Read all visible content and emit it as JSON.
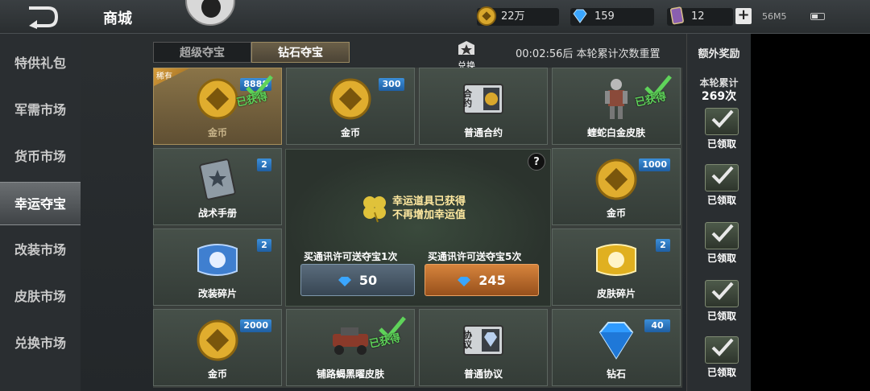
{
  "header": {
    "title": "商城",
    "gold": "22万",
    "diamond": "159",
    "card": "12",
    "add": "+",
    "network": "56M5"
  },
  "sidebar": {
    "items": [
      {
        "label": "特供礼包"
      },
      {
        "label": "军需市场"
      },
      {
        "label": "货币市场"
      },
      {
        "label": "幸运夺宝"
      },
      {
        "label": "改装市场"
      },
      {
        "label": "皮肤市场"
      },
      {
        "label": "兑换市场"
      }
    ],
    "active_index": 3
  },
  "tabs": [
    {
      "label": "超级夺宝",
      "active": false
    },
    {
      "label": "钻石夺宝",
      "active": true
    }
  ],
  "exchange_label": "兑换",
  "timer_text": "00:02:56后 本轮累计次数重置",
  "cells": [
    {
      "label": "金币",
      "badge": "8888",
      "obtained": "已获得",
      "tag": "稀有"
    },
    {
      "label": "金币",
      "badge": "300"
    },
    {
      "label": "普通合约",
      "icon_text": "合约"
    },
    {
      "label": "蝰蛇白金皮肤",
      "obtained": "已获得"
    },
    {
      "label": "战术手册",
      "badge": "2"
    },
    {
      "label": "金币",
      "badge": "1000"
    },
    {
      "label": "改装碎片",
      "badge": "2"
    },
    {
      "label": "皮肤碎片",
      "badge": "2"
    },
    {
      "label": "金币",
      "badge": "2000"
    },
    {
      "label": "铺路蝎黑曜皮肤",
      "obtained": "已获得"
    },
    {
      "label": "普通协议",
      "icon_text": "协议"
    },
    {
      "label": "钻石",
      "badge": "40"
    }
  ],
  "center": {
    "help": "?",
    "lucky_line1": "幸运道具已获得",
    "lucky_line2": "不再增加幸运值",
    "buy1_label": "买通讯许可送夺宝1次",
    "buy1_price": "50",
    "buy5_label": "买通讯许可送夺宝5次",
    "buy5_price": "245"
  },
  "right_panel": {
    "title": "额外奖励",
    "sub": "本轮累计",
    "count": "269次",
    "claimed": [
      "已领取",
      "已领取",
      "已领取",
      "已领取",
      "已领取"
    ]
  },
  "colors": {
    "obtained_green": "#5fd35a",
    "badge_blue": "#2f78c0",
    "buy_orange": "#c0702e"
  }
}
